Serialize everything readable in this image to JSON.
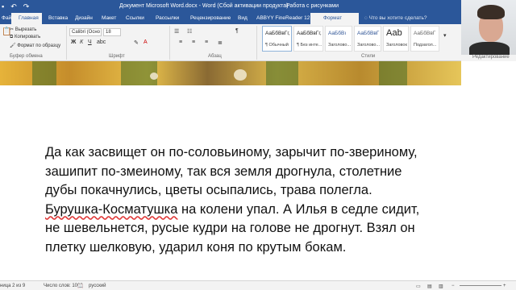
{
  "titlebar": {
    "document_title": "Документ Microsoft Word.docx - Word (Сбой активации продукта)",
    "context_title": "Работа с рисунками"
  },
  "tabs": [
    {
      "label": "Файл"
    },
    {
      "label": "Главная"
    },
    {
      "label": "Вставка"
    },
    {
      "label": "Дизайн"
    },
    {
      "label": "Макет"
    },
    {
      "label": "Ссылки"
    },
    {
      "label": "Рассылки"
    },
    {
      "label": "Рецензирование"
    },
    {
      "label": "Вид"
    },
    {
      "label": "ABBYY FineReader 12"
    },
    {
      "label": "Формат"
    }
  ],
  "tellme": "Что вы хотите сделать?",
  "ribbon": {
    "clipboard": {
      "paste_label": "Вставить",
      "cut": "Вырезать",
      "copy": "Копировать",
      "format_painter": "Формат по образцу",
      "group_label": "Буфер обмена"
    },
    "font": {
      "font_name": "Calibri (Осно",
      "font_size": "18",
      "group_label": "Шрифт"
    },
    "paragraph": {
      "group_label": "Абзац"
    },
    "styles": {
      "group_label": "Стили",
      "items": [
        {
          "sample": "АаБбВвГг,",
          "name": "¶ Обычный"
        },
        {
          "sample": "АаБбВвГг,",
          "name": "¶ Без инте..."
        },
        {
          "sample": "АаБбВı",
          "name": "Заголово..."
        },
        {
          "sample": "АаБбВвГ",
          "name": "Заголово..."
        },
        {
          "sample": "Ааb",
          "name": "Заголовок"
        },
        {
          "sample": "АаБбВвГ",
          "name": "Подзагол..."
        }
      ]
    },
    "editing": {
      "group_label": "Редактирование"
    }
  },
  "document": {
    "lines": [
      "Да как засвищет он по-соловьиному, зарычит по-звериному,",
      "зашипит по-змеиному, так вся земля дрогнула, столетние",
      "дубы покачнулись, цветы осыпались, трава полегла."
    ],
    "misspelled": "Бурушка-Косматушка",
    "line4_rest": " на колени упал. А Илья в седле сидит,",
    "lines_after": [
      "не шевельнется, русые кудри на голове не дрогнут. Взял он",
      "плетку шелковую, ударил коня по крутым бокам."
    ]
  },
  "statusbar": {
    "page": "ница 2 из 9",
    "words": "Число слов: 1009",
    "language": "русский"
  }
}
